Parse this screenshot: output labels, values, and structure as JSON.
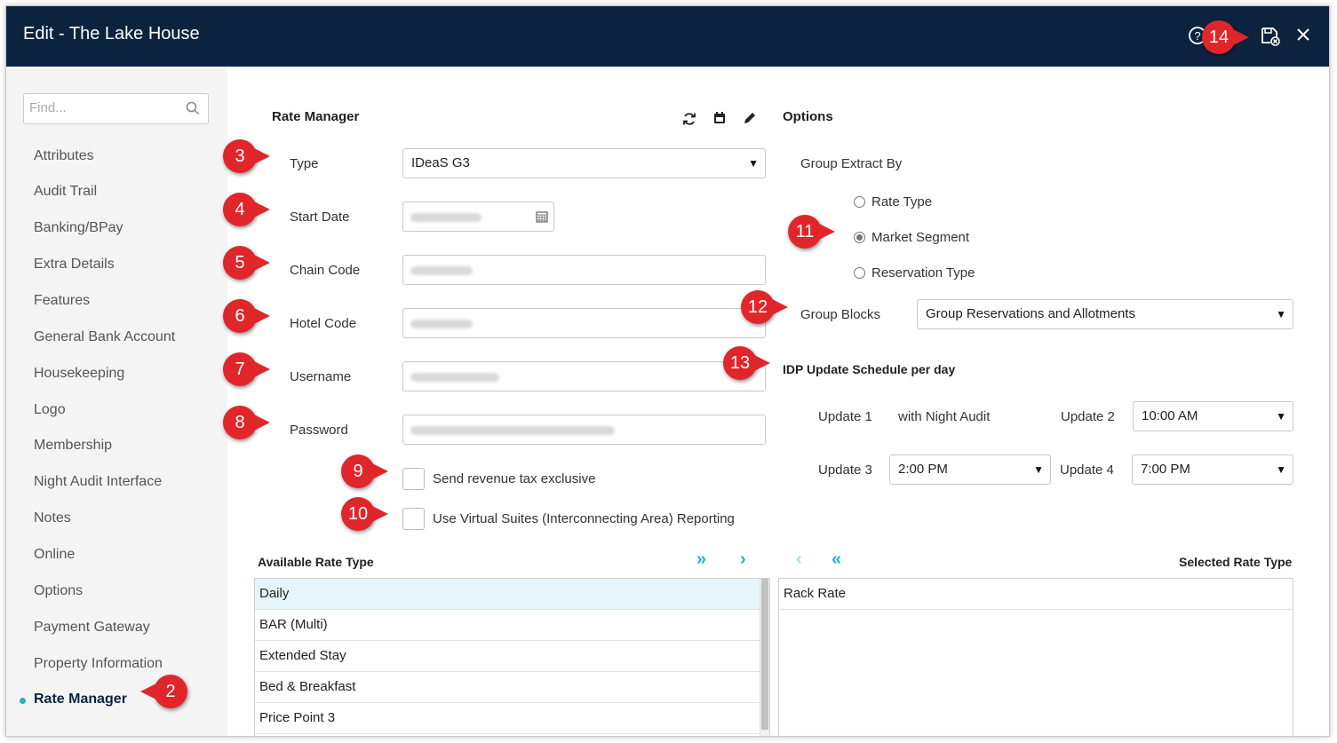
{
  "window": {
    "title": "Edit - The Lake House"
  },
  "sidebar": {
    "find_placeholder": "Find...",
    "items": [
      {
        "label": "Attributes"
      },
      {
        "label": "Audit Trail"
      },
      {
        "label": "Banking/BPay"
      },
      {
        "label": "Extra Details"
      },
      {
        "label": "Features"
      },
      {
        "label": "General Bank Account"
      },
      {
        "label": "Housekeeping"
      },
      {
        "label": "Logo"
      },
      {
        "label": "Membership"
      },
      {
        "label": "Night Audit Interface"
      },
      {
        "label": "Notes"
      },
      {
        "label": "Online"
      },
      {
        "label": "Options"
      },
      {
        "label": "Payment Gateway"
      },
      {
        "label": "Property Information"
      },
      {
        "label": "Rate Manager"
      }
    ],
    "active_item": "Rate Manager"
  },
  "rate_manager": {
    "title": "Rate Manager",
    "type_label": "Type",
    "type_value": "IDeaS G3",
    "start_date_label": "Start Date",
    "chain_code_label": "Chain Code",
    "hotel_code_label": "Hotel Code",
    "username_label": "Username",
    "password_label": "Password",
    "send_revenue_label": "Send revenue tax exclusive",
    "virtual_suites_label": "Use Virtual Suites (Interconnecting Area) Reporting"
  },
  "options": {
    "title": "Options",
    "group_extract_label": "Group Extract By",
    "radio_rate_type": "Rate Type",
    "radio_market_segment": "Market Segment",
    "radio_reservation_type": "Reservation Type",
    "selected_radio": "Market Segment",
    "group_blocks_label": "Group Blocks",
    "group_blocks_value": "Group Reservations and Allotments",
    "idp_title": "IDP Update Schedule per day",
    "update1_label": "Update 1",
    "update1_value": "with Night Audit",
    "update2_label": "Update 2",
    "update2_value": "10:00 AM",
    "update3_label": "Update 3",
    "update3_value": "2:00 PM",
    "update4_label": "Update 4",
    "update4_value": "7:00 PM"
  },
  "rate_types": {
    "available_title": "Available Rate Type",
    "selected_title": "Selected Rate Type",
    "available": [
      "Daily",
      "BAR (Multi)",
      "Extended Stay",
      "Bed & Breakfast",
      "Price Point 3"
    ],
    "selected": [
      "Rack Rate"
    ]
  },
  "callouts": [
    "2",
    "3",
    "4",
    "5",
    "6",
    "7",
    "8",
    "9",
    "10",
    "11",
    "12",
    "13",
    "14"
  ],
  "colors": {
    "titlebar": "#0c2340",
    "accent": "#1fb5c4",
    "callout": "#e0262a",
    "selected_row": "#e5f6fb"
  }
}
